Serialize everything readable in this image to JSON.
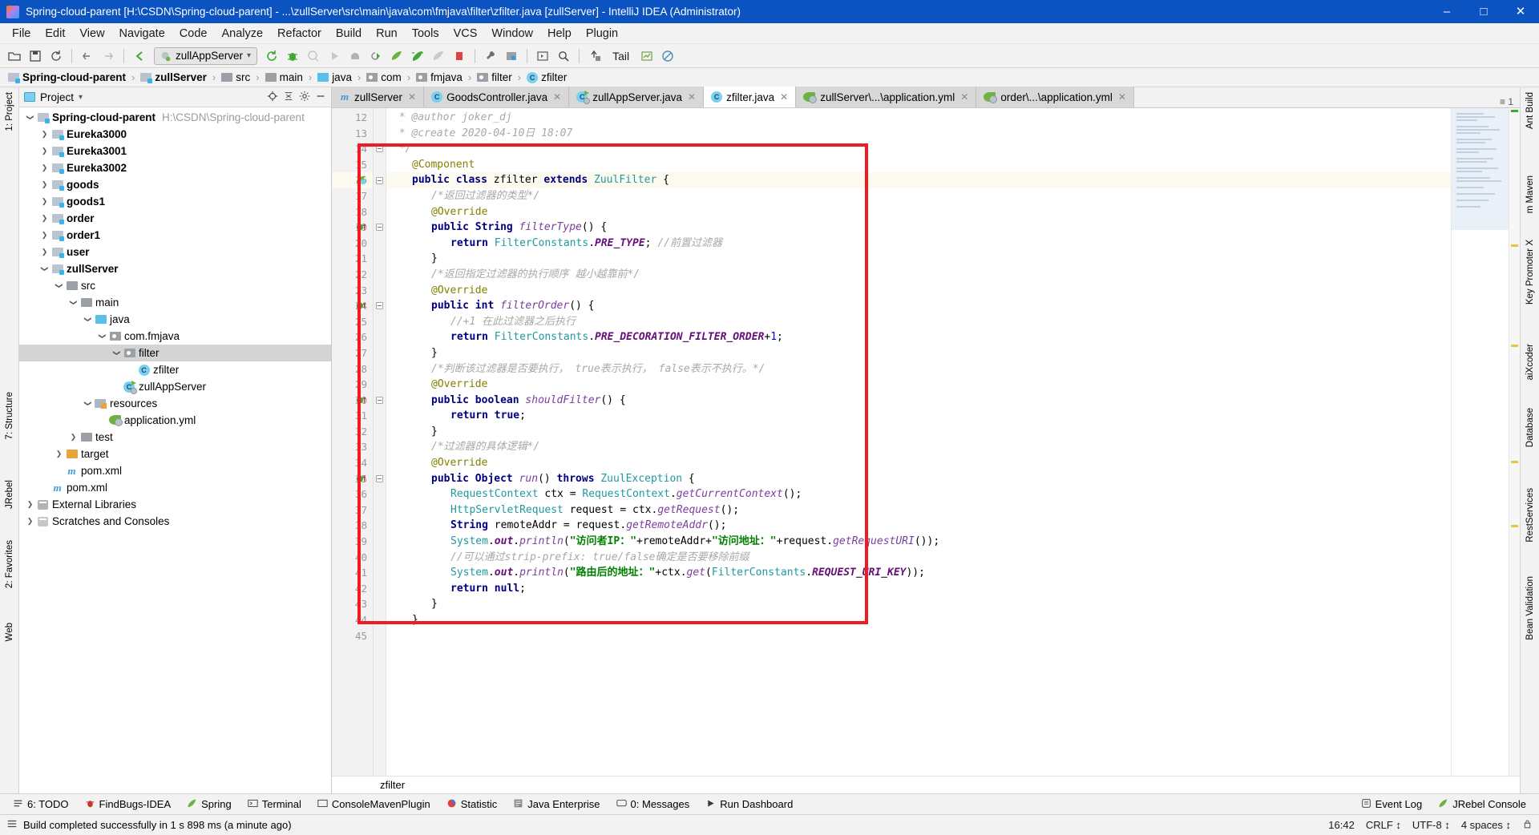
{
  "window": {
    "title": "Spring-cloud-parent [H:\\CSDN\\Spring-cloud-parent] - ...\\zullServer\\src\\main\\java\\com\\fmjava\\filter\\zfilter.java [zullServer] - IntelliJ IDEA (Administrator)",
    "minimize": "–",
    "maximize": "□",
    "close": "✕"
  },
  "menubar": {
    "items": [
      "File",
      "Edit",
      "View",
      "Navigate",
      "Code",
      "Analyze",
      "Refactor",
      "Build",
      "Run",
      "Tools",
      "VCS",
      "Window",
      "Help",
      "Plugin"
    ]
  },
  "toolbar": {
    "run_config": "zullAppServer",
    "tail_label": "Tail",
    "icons": [
      "open-project-icon",
      "save-all-icon",
      "sync-icon",
      "back-icon",
      "forward-icon",
      "jump-to-source-icon",
      "rerun-icon",
      "debug-icon",
      "coverage-icon",
      "run-icon",
      "stop-icon",
      "attach-debugger-icon",
      "jrebel-run-icon",
      "jrebel-debug-icon",
      "jrebel-profile-icon",
      "stop-red-icon",
      "settings-wrench-icon",
      "project-structure-icon",
      "terminal-run-icon",
      "search-everywhere-icon",
      "update-icon",
      "chart-icon",
      "no-entry-icon"
    ]
  },
  "breadcrumb": {
    "items": [
      {
        "label": "Spring-cloud-parent",
        "icon": "module-folder-icon",
        "bold": true
      },
      {
        "label": "zullServer",
        "icon": "module-folder-icon",
        "bold": true
      },
      {
        "label": "src",
        "icon": "folder-icon",
        "bold": false
      },
      {
        "label": "main",
        "icon": "folder-icon",
        "bold": false
      },
      {
        "label": "java",
        "icon": "source-folder-icon",
        "bold": false
      },
      {
        "label": "com",
        "icon": "package-icon",
        "bold": false
      },
      {
        "label": "fmjava",
        "icon": "package-icon",
        "bold": false
      },
      {
        "label": "filter",
        "icon": "package-icon",
        "bold": false
      },
      {
        "label": "zfilter",
        "icon": "class-icon",
        "bold": false
      }
    ],
    "separator": "›"
  },
  "left_rail": [
    {
      "label": "1: Project",
      "name": "rail-project"
    },
    {
      "label": "7: Structure",
      "name": "rail-structure"
    },
    {
      "label": "JRebel",
      "name": "rail-jrebel"
    },
    {
      "label": "2: Favorites",
      "name": "rail-favorites"
    },
    {
      "label": "Web",
      "name": "rail-web"
    }
  ],
  "right_rail": [
    {
      "label": "Ant Build",
      "name": "rail-ant-build"
    },
    {
      "label": "m Maven",
      "name": "rail-maven"
    },
    {
      "label": "Key Promoter X",
      "name": "rail-key-promoter"
    },
    {
      "label": "aiXcoder",
      "name": "rail-aixcoder"
    },
    {
      "label": "Database",
      "name": "rail-database"
    },
    {
      "label": "RestServices",
      "name": "rail-restservices"
    },
    {
      "label": "Bean Validation",
      "name": "rail-bean-validation"
    }
  ],
  "project_panel": {
    "title": "Project",
    "header_icons": [
      "locate-icon",
      "collapse-all-icon",
      "settings-icon",
      "hide-icon"
    ],
    "tree": [
      {
        "label": "Spring-cloud-parent",
        "sub": "H:\\CSDN\\Spring-cloud-parent",
        "depth": 0,
        "arrow": "down",
        "icon": "module-folder-icon",
        "bold": true,
        "selected": false
      },
      {
        "label": "Eureka3000",
        "sub": "",
        "depth": 1,
        "arrow": "right",
        "icon": "module-folder-icon",
        "bold": true,
        "selected": false
      },
      {
        "label": "Eureka3001",
        "sub": "",
        "depth": 1,
        "arrow": "right",
        "icon": "module-folder-icon",
        "bold": true,
        "selected": false
      },
      {
        "label": "Eureka3002",
        "sub": "",
        "depth": 1,
        "arrow": "right",
        "icon": "module-folder-icon",
        "bold": true,
        "selected": false
      },
      {
        "label": "goods",
        "sub": "",
        "depth": 1,
        "arrow": "right",
        "icon": "module-folder-icon",
        "bold": true,
        "selected": false
      },
      {
        "label": "goods1",
        "sub": "",
        "depth": 1,
        "arrow": "right",
        "icon": "module-folder-icon",
        "bold": true,
        "selected": false
      },
      {
        "label": "order",
        "sub": "",
        "depth": 1,
        "arrow": "right",
        "icon": "module-folder-icon",
        "bold": true,
        "selected": false
      },
      {
        "label": "order1",
        "sub": "",
        "depth": 1,
        "arrow": "right",
        "icon": "module-folder-icon",
        "bold": true,
        "selected": false
      },
      {
        "label": "user",
        "sub": "",
        "depth": 1,
        "arrow": "right",
        "icon": "module-folder-icon",
        "bold": true,
        "selected": false
      },
      {
        "label": "zullServer",
        "sub": "",
        "depth": 1,
        "arrow": "down",
        "icon": "module-folder-icon",
        "bold": true,
        "selected": false
      },
      {
        "label": "src",
        "sub": "",
        "depth": 2,
        "arrow": "down",
        "icon": "folder-icon",
        "bold": false,
        "selected": false
      },
      {
        "label": "main",
        "sub": "",
        "depth": 3,
        "arrow": "down",
        "icon": "folder-icon",
        "bold": false,
        "selected": false
      },
      {
        "label": "java",
        "sub": "",
        "depth": 4,
        "arrow": "down",
        "icon": "source-folder-icon",
        "bold": false,
        "selected": false
      },
      {
        "label": "com.fmjava",
        "sub": "",
        "depth": 5,
        "arrow": "down",
        "icon": "package-icon",
        "bold": false,
        "selected": false
      },
      {
        "label": "filter",
        "sub": "",
        "depth": 6,
        "arrow": "down",
        "icon": "package-icon",
        "bold": false,
        "selected": true
      },
      {
        "label": "zfilter",
        "sub": "",
        "depth": 7,
        "arrow": "none",
        "icon": "class-icon",
        "bold": false,
        "selected": false
      },
      {
        "label": "zullAppServer",
        "sub": "",
        "depth": 6,
        "arrow": "none",
        "icon": "spring-class-icon",
        "bold": false,
        "selected": false
      },
      {
        "label": "resources",
        "sub": "",
        "depth": 4,
        "arrow": "down",
        "icon": "resources-folder-icon",
        "bold": false,
        "selected": false
      },
      {
        "label": "application.yml",
        "sub": "",
        "depth": 5,
        "arrow": "none",
        "icon": "spring-yml-icon",
        "bold": false,
        "selected": false
      },
      {
        "label": "test",
        "sub": "",
        "depth": 3,
        "arrow": "right",
        "icon": "folder-icon",
        "bold": false,
        "selected": false
      },
      {
        "label": "target",
        "sub": "",
        "depth": 2,
        "arrow": "right",
        "icon": "target-folder-icon",
        "bold": false,
        "selected": false
      },
      {
        "label": "pom.xml",
        "sub": "",
        "depth": 2,
        "arrow": "none",
        "icon": "maven-icon",
        "bold": false,
        "selected": false
      },
      {
        "label": "pom.xml",
        "sub": "",
        "depth": 1,
        "arrow": "none",
        "icon": "maven-icon",
        "bold": false,
        "selected": false
      },
      {
        "label": "External Libraries",
        "sub": "",
        "depth": 0,
        "arrow": "right",
        "icon": "library-icon",
        "bold": false,
        "selected": false
      },
      {
        "label": "Scratches and Consoles",
        "sub": "",
        "depth": 0,
        "arrow": "right",
        "icon": "scratches-icon",
        "bold": false,
        "selected": false
      }
    ]
  },
  "editor": {
    "tabs": [
      {
        "label": "zullServer",
        "icon": "maven-icon",
        "active": false
      },
      {
        "label": "GoodsController.java",
        "icon": "class-icon",
        "active": false
      },
      {
        "label": "zullAppServer.java",
        "icon": "spring-class-icon",
        "active": false
      },
      {
        "label": "zfilter.java",
        "icon": "class-icon",
        "active": true
      },
      {
        "label": "zullServer\\...\\application.yml",
        "icon": "spring-yml-icon",
        "active": false
      },
      {
        "label": "order\\...\\application.yml",
        "icon": "spring-yml-icon",
        "active": false
      }
    ],
    "tab_overflow": "≡ 1",
    "bottom_breadcrumb": "zfilter",
    "first_line_number": 12,
    "lines": [
      {
        "n": 12,
        "indent": 0,
        "text": " * @author joker_dj",
        "kind": "javadoc"
      },
      {
        "n": 13,
        "indent": 0,
        "text": " * @create 2020-04-10日 18:07",
        "kind": "javadoc"
      },
      {
        "n": 14,
        "indent": 0,
        "text": " */",
        "kind": "javadoc"
      },
      {
        "n": 15,
        "indent": 1,
        "text": "@Component",
        "kind": "annotation"
      },
      {
        "n": 16,
        "indent": 1,
        "text": "public class zfilter extends ZuulFilter {",
        "kind": "code",
        "highlight": true
      },
      {
        "n": 17,
        "indent": 2,
        "text": "/*返回过滤器的类型*/",
        "kind": "comment"
      },
      {
        "n": 18,
        "indent": 2,
        "text": "@Override",
        "kind": "annotation"
      },
      {
        "n": 19,
        "indent": 2,
        "text": "public String filterType() {",
        "kind": "code"
      },
      {
        "n": 20,
        "indent": 3,
        "text": "return FilterConstants.PRE_TYPE; //前置过滤器",
        "kind": "code"
      },
      {
        "n": 21,
        "indent": 2,
        "text": "}",
        "kind": "code"
      },
      {
        "n": 22,
        "indent": 2,
        "text": "/*返回指定过滤器的执行顺序 越小越靠前*/",
        "kind": "comment"
      },
      {
        "n": 23,
        "indent": 2,
        "text": "@Override",
        "kind": "annotation"
      },
      {
        "n": 24,
        "indent": 2,
        "text": "public int filterOrder() {",
        "kind": "code"
      },
      {
        "n": 25,
        "indent": 3,
        "text": "//+1 在此过滤器之后执行",
        "kind": "comment"
      },
      {
        "n": 26,
        "indent": 3,
        "text": "return FilterConstants.PRE_DECORATION_FILTER_ORDER+1;",
        "kind": "code"
      },
      {
        "n": 27,
        "indent": 2,
        "text": "}",
        "kind": "code"
      },
      {
        "n": 28,
        "indent": 2,
        "text": "/*判断该过滤器是否要执行， true表示执行， false表示不执行。*/",
        "kind": "comment"
      },
      {
        "n": 29,
        "indent": 2,
        "text": "@Override",
        "kind": "annotation"
      },
      {
        "n": 30,
        "indent": 2,
        "text": "public boolean shouldFilter() {",
        "kind": "code"
      },
      {
        "n": 31,
        "indent": 3,
        "text": "return true;",
        "kind": "code"
      },
      {
        "n": 32,
        "indent": 2,
        "text": "}",
        "kind": "code"
      },
      {
        "n": 33,
        "indent": 2,
        "text": "/*过滤器的具体逻辑*/",
        "kind": "comment"
      },
      {
        "n": 34,
        "indent": 2,
        "text": "@Override",
        "kind": "annotation"
      },
      {
        "n": 35,
        "indent": 2,
        "text": "public Object run() throws ZuulException {",
        "kind": "code"
      },
      {
        "n": 36,
        "indent": 3,
        "text": "RequestContext ctx = RequestContext.getCurrentContext();",
        "kind": "code"
      },
      {
        "n": 37,
        "indent": 3,
        "text": "HttpServletRequest request = ctx.getRequest();",
        "kind": "code"
      },
      {
        "n": 38,
        "indent": 3,
        "text": "String remoteAddr = request.getRemoteAddr();",
        "kind": "code"
      },
      {
        "n": 39,
        "indent": 3,
        "text": "System.out.println(\"访问者IP：\"+remoteAddr+\"访问地址：\"+request.getRequestURI());",
        "kind": "code"
      },
      {
        "n": 40,
        "indent": 3,
        "text": "//可以通过strip-prefix: true/false确定是否要移除前缀",
        "kind": "comment"
      },
      {
        "n": 41,
        "indent": 3,
        "text": "System.out.println(\"路由后的地址：\"+ctx.get(FilterConstants.REQUEST_URI_KEY));",
        "kind": "code"
      },
      {
        "n": 42,
        "indent": 3,
        "text": "return null;",
        "kind": "code"
      },
      {
        "n": 43,
        "indent": 2,
        "text": "}",
        "kind": "code"
      },
      {
        "n": 44,
        "indent": 1,
        "text": "}",
        "kind": "code"
      },
      {
        "n": 45,
        "indent": 0,
        "text": "",
        "kind": "code"
      }
    ]
  },
  "bottom_tools": [
    {
      "label": "6: TODO",
      "icon": "todo-icon",
      "underline": "6"
    },
    {
      "label": "FindBugs-IDEA",
      "icon": "findbugs-icon"
    },
    {
      "label": "Spring",
      "icon": "spring-leaf-icon"
    },
    {
      "label": "Terminal",
      "icon": "terminal-icon"
    },
    {
      "label": "ConsoleMavenPlugin",
      "icon": "maven-console-icon"
    },
    {
      "label": "Statistic",
      "icon": "statistic-icon"
    },
    {
      "label": "Java Enterprise",
      "icon": "java-enterprise-icon"
    },
    {
      "label": "0: Messages",
      "icon": "messages-icon",
      "underline": "0"
    },
    {
      "label": "Run Dashboard",
      "icon": "run-dashboard-icon"
    }
  ],
  "bottom_tools_right": [
    {
      "label": "Event Log",
      "icon": "event-log-icon"
    },
    {
      "label": "JRebel Console",
      "icon": "jrebel-icon"
    }
  ],
  "statusbar": {
    "message": "Build completed successfully in 1 s 898 ms (a minute ago)",
    "time": "16:42",
    "line_separator": "CRLF ↕",
    "encoding": "UTF-8 ↕",
    "indent": "4 spaces ↕",
    "lock_icon": "lock-icon"
  },
  "colors": {
    "title_bar": "#0a53c1",
    "accent_red": "#ee1c22",
    "keyword": "#000080",
    "string": "#008000",
    "comment": "#a8a8a8",
    "annotation": "#808000",
    "static_field": "#660e7a",
    "class_ref": "#20999d",
    "selection": "#d4d4d4",
    "caret_row": "#fcfaef"
  }
}
